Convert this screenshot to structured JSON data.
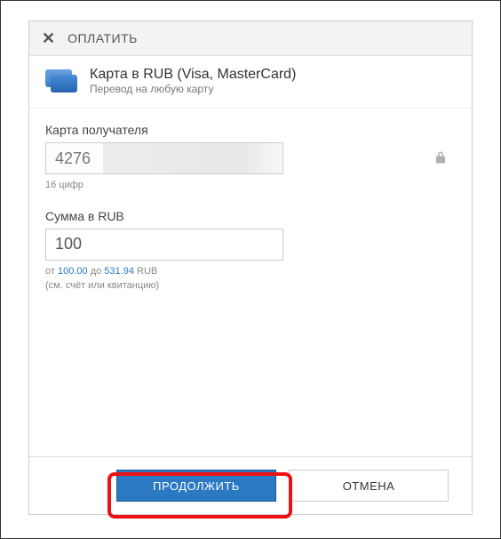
{
  "dialog": {
    "title": "ОПЛАТИТЬ"
  },
  "method": {
    "title": "Карта в RUB (Visa, MasterCard)",
    "subtitle": "Перевод на любую карту"
  },
  "recipient": {
    "label": "Карта получателя",
    "value": "4276",
    "hint": "16 цифр"
  },
  "amount": {
    "label": "Сумма в RUB",
    "value": "100",
    "hint_prefix": "от ",
    "min": "100.00",
    "hint_mid": " до ",
    "max": "531.94",
    "hint_suffix": " RUB",
    "hint_line2": "(см. счёт или квитанцию)"
  },
  "buttons": {
    "continue": "ПРОДОЛЖИТЬ",
    "cancel": "ОТМЕНА"
  }
}
